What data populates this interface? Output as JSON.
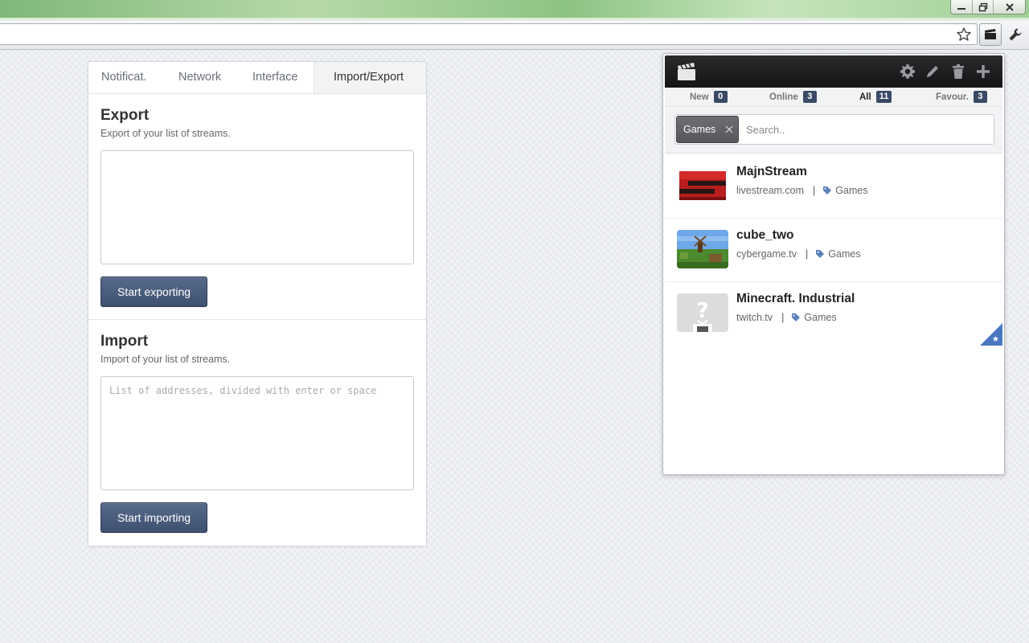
{
  "window": {
    "controls": [
      "minimize",
      "restore",
      "close"
    ]
  },
  "toolbar": {
    "icons": [
      "star-icon",
      "clapperboard-icon",
      "wrench-icon"
    ]
  },
  "settings": {
    "tabs": [
      {
        "label": "Notificat."
      },
      {
        "label": "Network"
      },
      {
        "label": "Interface"
      },
      {
        "label": "Import/Export",
        "active": true
      }
    ],
    "export": {
      "title": "Export",
      "description": "Export of your list of streams.",
      "textarea_value": "",
      "button": "Start exporting"
    },
    "import": {
      "title": "Import",
      "description": "Import of your list of streams.",
      "placeholder": "List of addresses, divided with enter or space",
      "button": "Start importing"
    }
  },
  "popup": {
    "header_icons": [
      "settings-icon",
      "edit-icon",
      "delete-icon",
      "add-icon"
    ],
    "counters": [
      {
        "label": "New",
        "count": "0"
      },
      {
        "label": "Online",
        "count": "3"
      },
      {
        "label": "All",
        "count": "11",
        "active": true
      },
      {
        "label": "Favour.",
        "count": "3"
      }
    ],
    "filter": {
      "tag": "Games",
      "search_placeholder": "Search..",
      "search_value": ""
    },
    "streams": [
      {
        "name": "MajnStream",
        "source": "livestream.com",
        "tag": "Games",
        "separator": "|"
      },
      {
        "name": "cube_two",
        "source": "cybergame.tv",
        "tag": "Games",
        "separator": "|"
      },
      {
        "name": "Minecraft. Industrial",
        "source": "twitch.tv",
        "tag": "Games",
        "separator": "|",
        "favourite": true
      }
    ]
  },
  "colors": {
    "accent": "#3f5170",
    "badge": "#3a4a66",
    "tag_icon": "#5b82b8",
    "header": "#1b1b1d"
  }
}
